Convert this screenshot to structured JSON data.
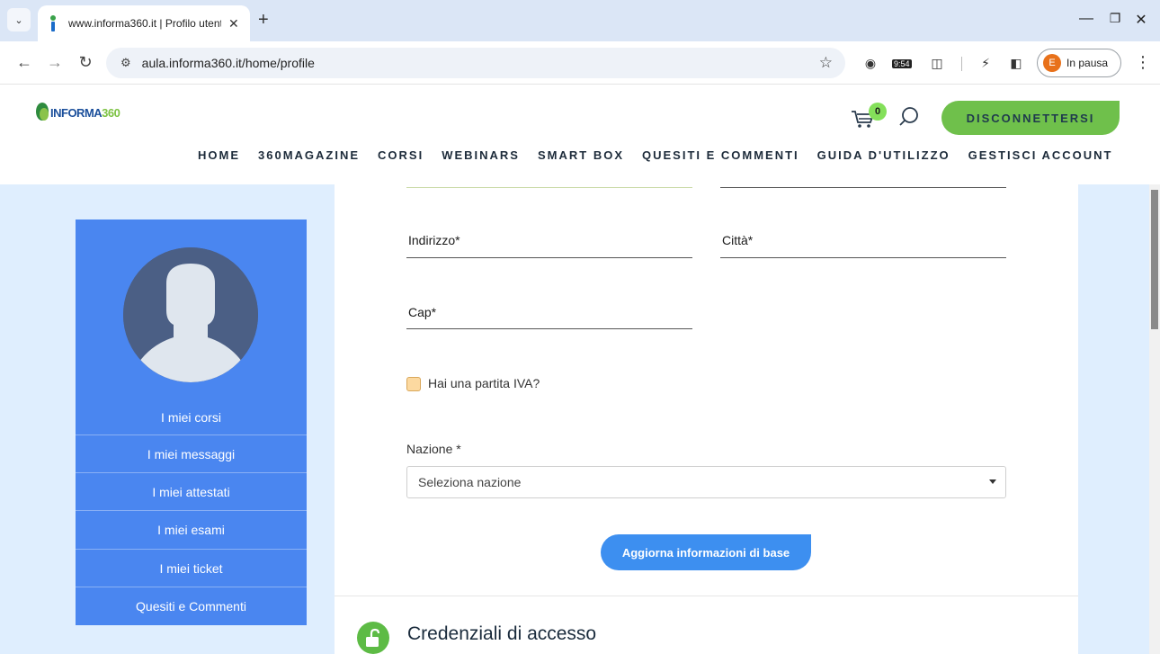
{
  "browser": {
    "tab_title": "www.informa360.it | Profilo utente",
    "url": "aula.informa360.it/home/profile",
    "extension_time": "9:54",
    "profile_initial": "E",
    "profile_status": "In pausa"
  },
  "site": {
    "logo_text_a": "INFORMA",
    "logo_text_b": "360",
    "cart_count": "0",
    "logout_label": "DISCONNETTERSI",
    "nav": [
      "HOME",
      "360MAGAZINE",
      "CORSI",
      "WEBINARS",
      "SMART BOX",
      "QUESITI E COMMENTI",
      "GUIDA D'UTILIZZO",
      "GESTISCI ACCOUNT"
    ]
  },
  "sidebar": {
    "links": [
      "I miei corsi",
      "I miei messaggi",
      "I miei attestati",
      "I miei esami",
      "I miei ticket",
      "Quesiti e Commenti"
    ]
  },
  "form": {
    "address_label": "Indirizzo*",
    "city_label": "Città*",
    "cap_label": "Cap*",
    "vat_label": "Hai una partita IVA?",
    "country_label": "Nazione *",
    "country_value": "Seleziona nazione",
    "update_button": "Aggiorna informazioni di base",
    "section_title": "Credenziali di accesso"
  },
  "colors": {
    "page_bg": "#dfeefe",
    "sidebar": "#4a86f0",
    "logout_button": "#6fc04b",
    "update_button": "#3d8ff0",
    "lock_badge": "#5dbb45"
  }
}
